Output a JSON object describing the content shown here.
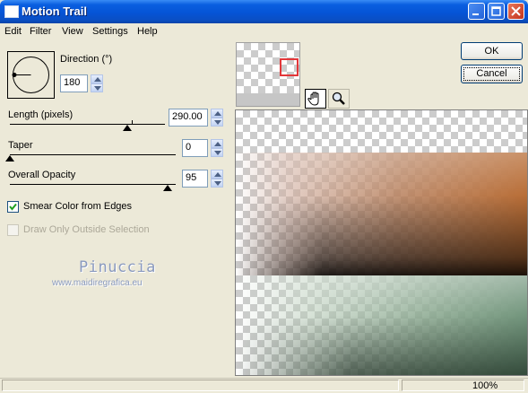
{
  "window": {
    "title": "Motion Trail"
  },
  "menu": [
    "Edit",
    "Filter",
    "View",
    "Settings",
    "Help"
  ],
  "direction": {
    "label": "Direction (°)",
    "value": "180"
  },
  "length": {
    "label": "Length (pixels)",
    "value": "290.00",
    "level_fraction": 0.71
  },
  "taper": {
    "label": "Taper",
    "value": "0",
    "level_fraction": 0.0
  },
  "opacity": {
    "label": "Overall Opacity",
    "value": "95",
    "level_fraction": 0.95
  },
  "smear": {
    "label": "Smear Color from Edges",
    "checked": true
  },
  "draw_outside": {
    "label": "Draw Only Outside Selection",
    "checked": false,
    "enabled": false
  },
  "watermark": {
    "name": "Pinuccia",
    "url": "www.maidiregrafica.eu"
  },
  "buttons": {
    "ok": "OK",
    "cancel": "Cancel"
  },
  "tools": [
    "hand-icon",
    "zoom-icon"
  ],
  "status": {
    "zoom": "100%"
  },
  "colors": {
    "title_bar": "#0554d6",
    "accent": "#003c74",
    "preview_orange": "#b86a36",
    "preview_green": "#8aa88e"
  }
}
